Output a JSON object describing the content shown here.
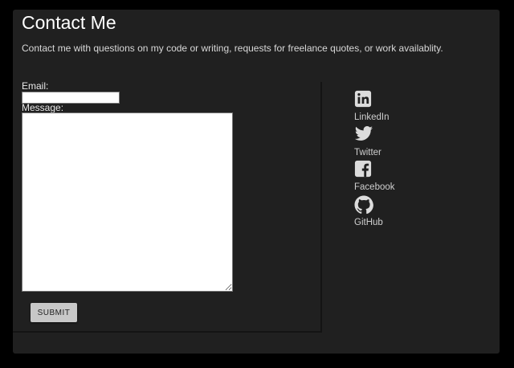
{
  "header": {
    "title": "Contact Me",
    "intro": "Contact me with questions on my code or writing, requests for freelance quotes, or work availablity."
  },
  "form": {
    "email_label": "Email:",
    "email_value": "",
    "message_label": "Message:",
    "message_value": "",
    "submit_label": "SUBMIT"
  },
  "social": {
    "items": [
      {
        "label": "LinkedIn",
        "icon": "linkedin-icon"
      },
      {
        "label": "Twitter",
        "icon": "twitter-icon"
      },
      {
        "label": "Facebook",
        "icon": "facebook-icon"
      },
      {
        "label": "GitHub",
        "icon": "github-icon"
      }
    ]
  },
  "colors": {
    "page_background": "#000000",
    "card_background": "#202020",
    "text": "#ffffff",
    "button": "#c8c8c8"
  }
}
